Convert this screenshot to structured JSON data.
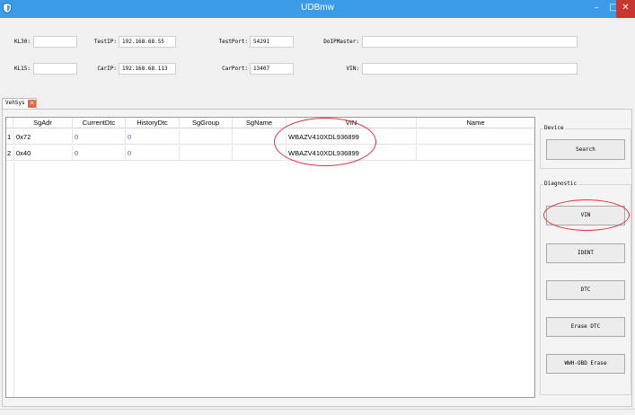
{
  "window": {
    "title": "UDBmw",
    "minimize_glyph": "–",
    "maximize_glyph": "□",
    "close_glyph": "✕"
  },
  "form": {
    "kl30_label": "KL30:",
    "kl30_value": "",
    "kl15_label": "KL15:",
    "kl15_value": "",
    "testip_label": "TestIP:",
    "testip_value": "192.168.68.55",
    "carip_label": "CarIP:",
    "carip_value": "192.168.68.113",
    "testport_label": "TestPort:",
    "testport_value": "54291",
    "carport_label": "CarPort:",
    "carport_value": "13407",
    "doip_label": "DoIPMaster:",
    "doip_value": "",
    "vin_label": "VIN:",
    "vin_value": ""
  },
  "tab": {
    "label": "VehSys",
    "close_glyph": "✕"
  },
  "grid": {
    "columns": [
      "SgAdr",
      "CurrentDtc",
      "HistoryDtc",
      "SgGroup",
      "SgName",
      "VIN",
      "Name"
    ],
    "rows": [
      {
        "index": "1",
        "sgadr": "0x72",
        "current": "0",
        "history": "0",
        "sggroup": "",
        "sgname": "",
        "vin": "WBAZV410XDL936899",
        "name": ""
      },
      {
        "index": "2",
        "sgadr": "0x40",
        "current": "0",
        "history": "0",
        "sggroup": "",
        "sgname": "",
        "vin": "WBAZV410XDL936899",
        "name": ""
      }
    ]
  },
  "device": {
    "title": "Device",
    "search_label": "Search"
  },
  "diagnostic": {
    "title": "Diagnostic",
    "vin_label": "VIN",
    "ident_label": "IDENT",
    "dtc_label": "DTC",
    "erase_dtc_label": "Erase DTC",
    "wwh_label": "WWH-OBD Erase"
  },
  "colors": {
    "titlebar": "#3c9be8",
    "annotation": "#e0313a",
    "dtc_value": "#5a5ad8",
    "close_button": "#c7372f",
    "tab_close": "#e8613a"
  }
}
